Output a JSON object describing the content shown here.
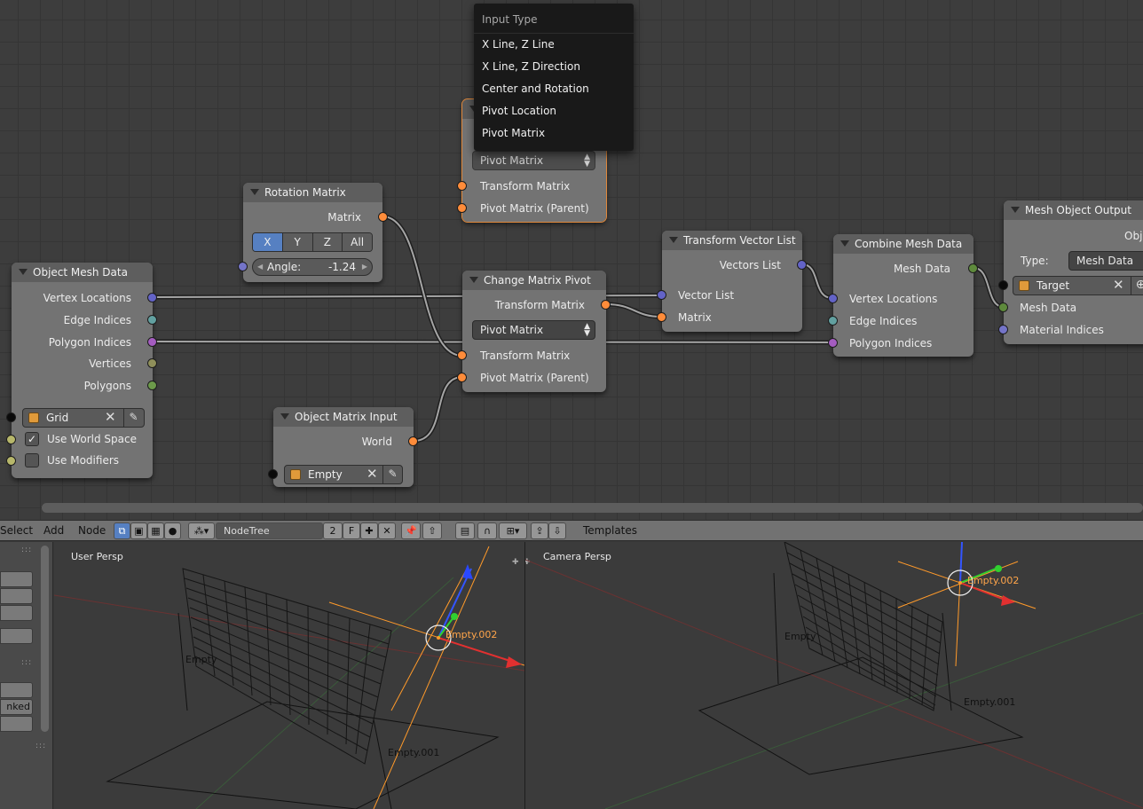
{
  "popup": {
    "title": "Input Type",
    "items": [
      "X Line, Z Line",
      "X Line, Z Direction",
      "Center and Rotation",
      "Pivot Location",
      "Pivot Matrix"
    ]
  },
  "nodes": {
    "object_mesh_data": {
      "title": "Object Mesh Data",
      "outputs": [
        "Vertex Locations",
        "Edge Indices",
        "Polygon Indices",
        "Vertices",
        "Polygons"
      ],
      "object": "Grid",
      "use_world_space": "Use World Space",
      "use_modifiers": "Use Modifiers",
      "use_world_space_checked": true,
      "use_modifiers_checked": false
    },
    "rotation_matrix": {
      "title": "Rotation Matrix",
      "output": "Matrix",
      "axes": [
        "X",
        "Y",
        "Z",
        "All"
      ],
      "selected_axis": "X",
      "angle_label": "Angle:",
      "angle_value": "-1.24"
    },
    "change_matrix_pivot_top": {
      "mode": "Pivot Matrix",
      "inputs": [
        "Transform Matrix",
        "Pivot Matrix (Parent)"
      ]
    },
    "change_matrix_pivot": {
      "title": "Change Matrix Pivot",
      "output": "Transform Matrix",
      "mode": "Pivot Matrix",
      "inputs": [
        "Transform Matrix",
        "Pivot Matrix (Parent)"
      ]
    },
    "object_matrix_input": {
      "title": "Object Matrix Input",
      "output": "World",
      "object": "Empty"
    },
    "transform_vector_list": {
      "title": "Transform Vector List",
      "output": "Vectors List",
      "inputs": [
        "Vector List",
        "Matrix"
      ]
    },
    "combine_mesh_data": {
      "title": "Combine Mesh Data",
      "output": "Mesh Data",
      "inputs": [
        "Vertex Locations",
        "Edge Indices",
        "Polygon Indices"
      ]
    },
    "mesh_object_output": {
      "title": "Mesh Object Output",
      "output_partial": "Obj",
      "type_label": "Type:",
      "type_value": "Mesh Data",
      "object": "Target",
      "inputs": [
        "Mesh Data",
        "Material Indices"
      ]
    }
  },
  "toolbar": {
    "menus": [
      "Select",
      "Add",
      "Node"
    ],
    "nodetree_name": "NodeTree",
    "users_count": "2",
    "fake_user": "F",
    "templates": "Templates"
  },
  "viewport_left": {
    "label": "User Persp",
    "objects": [
      "Empty",
      "Empty.002",
      "Empty.001"
    ],
    "tools_partial": "nked"
  },
  "viewport_right": {
    "label": "Camera Persp",
    "objects": [
      "Empty",
      "Empty.002",
      "Empty.001"
    ]
  },
  "colors": {
    "selection": "#ffa54a",
    "matrix_socket": "#ff8c3a",
    "active_button": "#5680c2"
  }
}
